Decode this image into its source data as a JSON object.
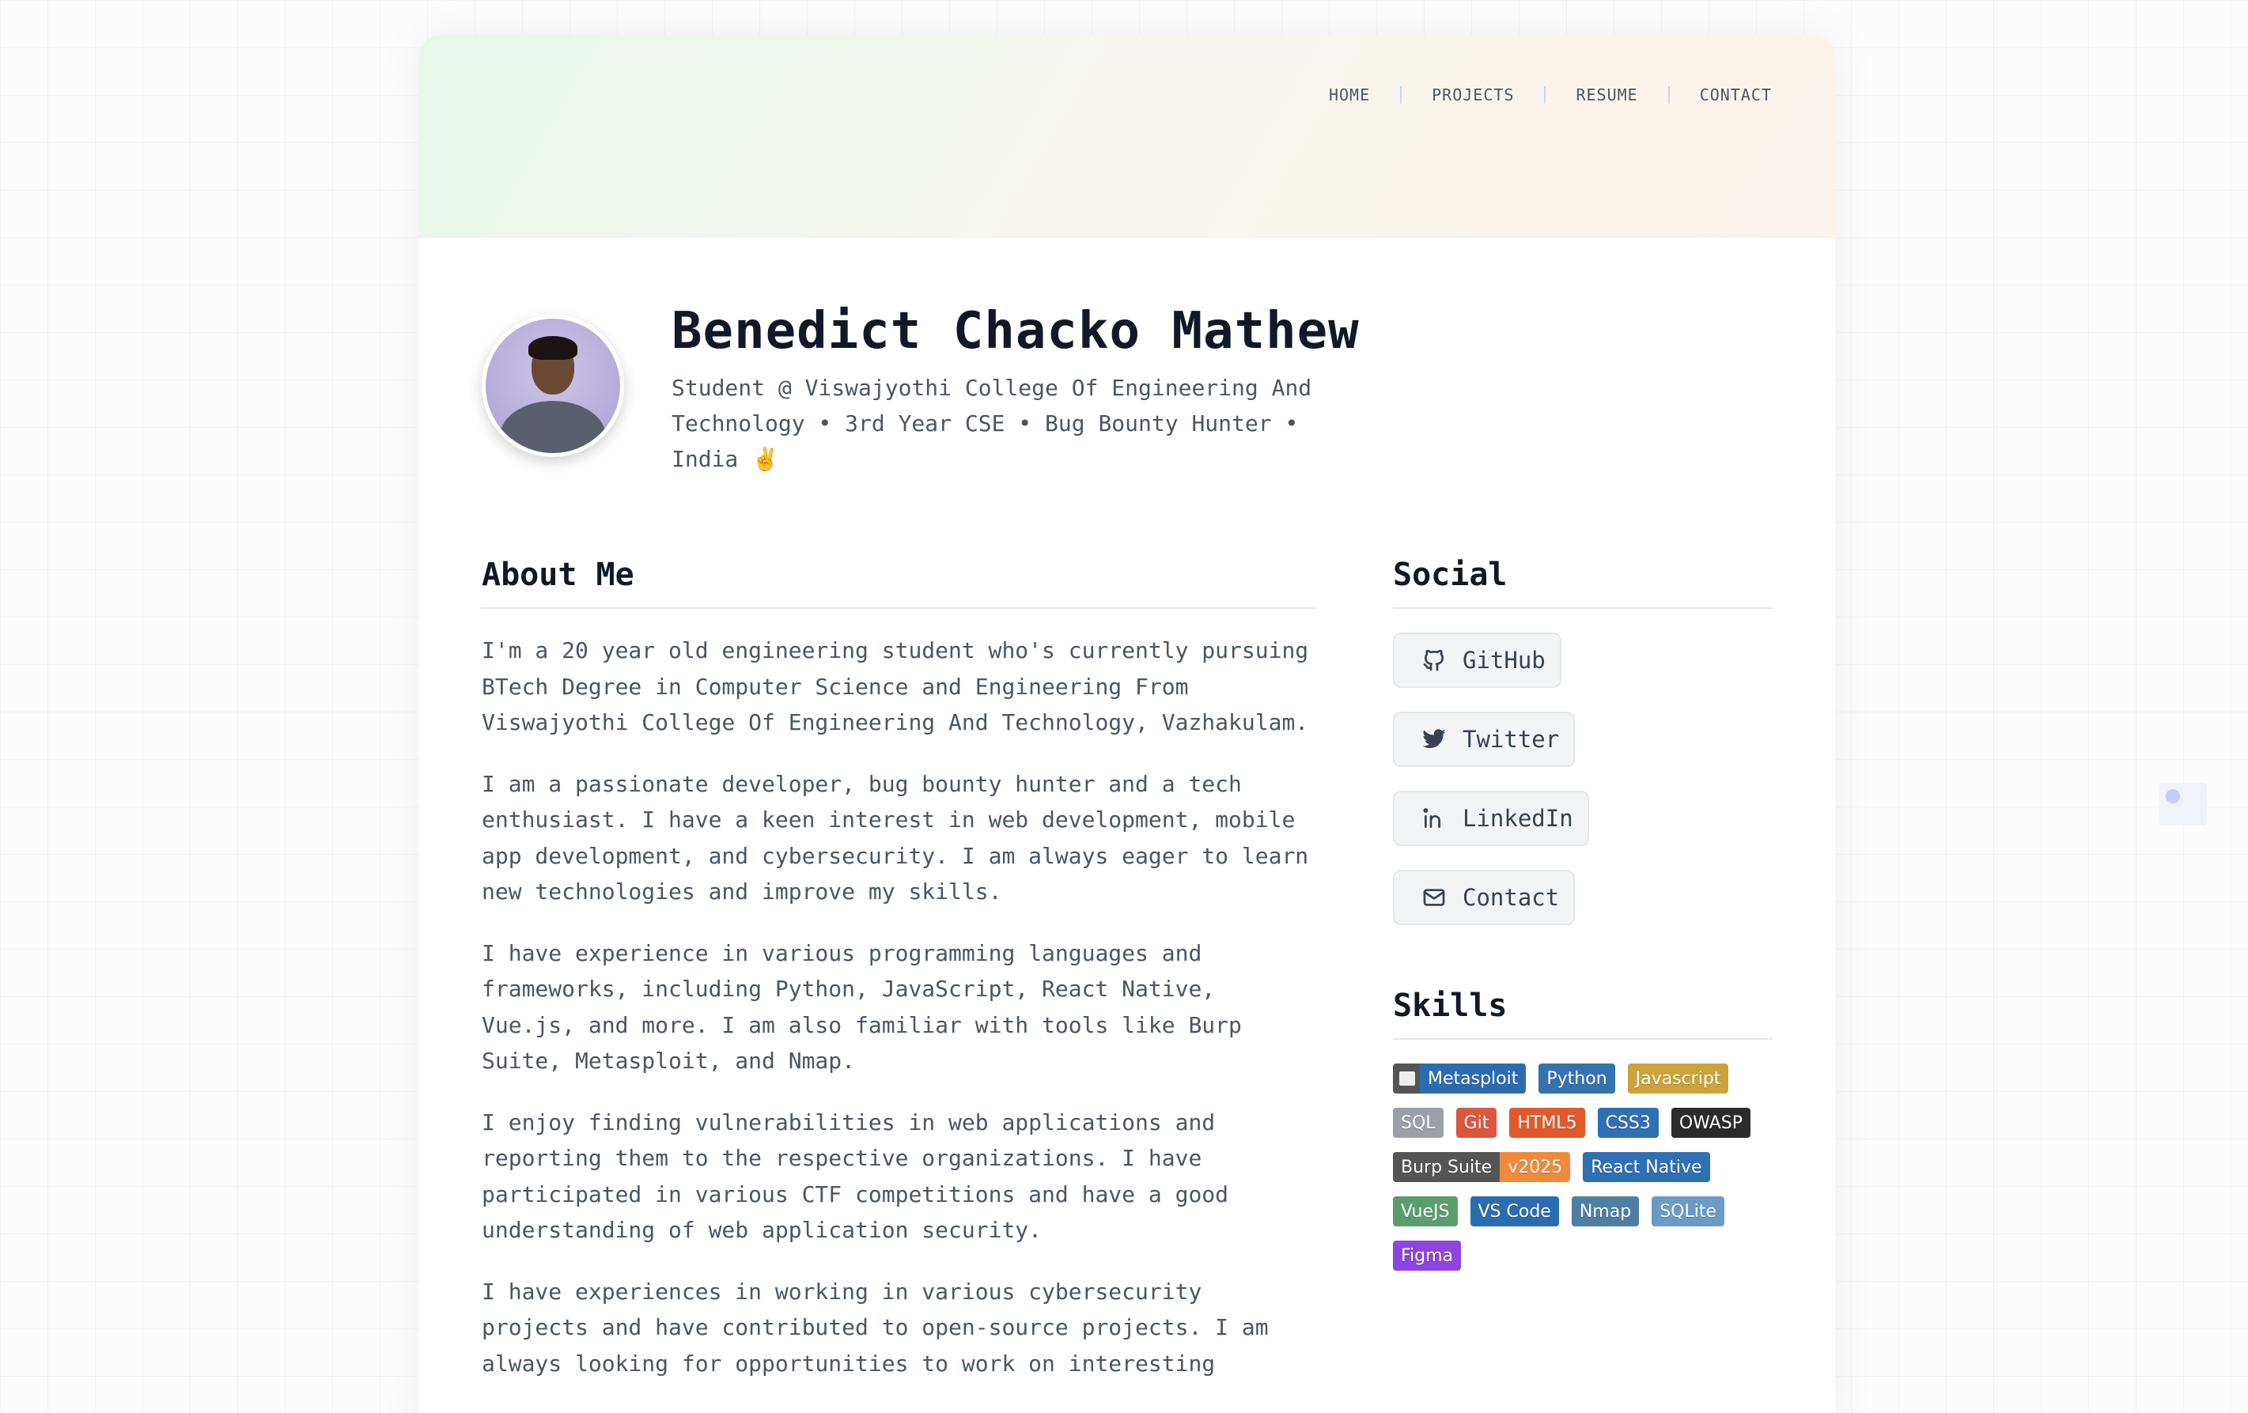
{
  "nav": {
    "items": [
      {
        "label": "HOME"
      },
      {
        "label": "PROJECTS"
      },
      {
        "label": "RESUME"
      },
      {
        "label": "CONTACT"
      }
    ]
  },
  "profile": {
    "name": "Benedict Chacko Mathew",
    "tagline": "Student @ Viswajyothi College Of Engineering And Technology • 3rd Year CSE • Bug Bounty Hunter • India ✌️"
  },
  "about": {
    "title": "About Me",
    "paragraphs": [
      "I'm a 20 year old engineering student who's currently pursuing BTech Degree in Computer Science and Engineering From Viswajyothi College Of Engineering And Technology, Vazhakulam.",
      "I am a passionate developer, bug bounty hunter and a tech enthusiast. I have a keen interest in web development, mobile app development, and cybersecurity. I am always eager to learn new technologies and improve my skills.",
      "I have experience in various programming languages and frameworks, including Python, JavaScript, React Native, Vue.js, and more. I am also familiar with tools like Burp Suite, Metasploit, and Nmap.",
      "I enjoy finding vulnerabilities in web applications and reporting them to the respective organizations. I have participated in various CTF competitions and have a good understanding of web application security.",
      "I have experiences in working in various cybersecurity projects and have contributed to open-source projects. I am always looking for opportunities to work on interesting"
    ]
  },
  "social": {
    "title": "Social",
    "links": [
      {
        "label": "GitHub",
        "icon": "github-icon"
      },
      {
        "label": "Twitter",
        "icon": "twitter-icon"
      },
      {
        "label": "LinkedIn",
        "icon": "linkedin-icon"
      },
      {
        "label": "Contact",
        "icon": "mail-icon"
      }
    ]
  },
  "skills": {
    "title": "Skills",
    "badges": [
      {
        "label": "Metasploit",
        "color": "#2b6cb0",
        "icon": "terminal-icon"
      },
      {
        "label": "Python",
        "color": "#3572b0"
      },
      {
        "label": "Javascript",
        "color": "#cba33a"
      },
      {
        "label": "SQL",
        "color": "#9aa0a6"
      },
      {
        "label": "Git",
        "color": "#d9583f"
      },
      {
        "label": "HTML5",
        "color": "#e05a2b"
      },
      {
        "label": "CSS3",
        "color": "#2f6fb3"
      },
      {
        "label": "OWASP",
        "color": "#2b2b2b"
      },
      {
        "label": "Burp Suite",
        "color": "#555555",
        "version": "v2025",
        "version_color": "#f08a3a"
      },
      {
        "label": "React Native",
        "color": "#2f6fb3"
      },
      {
        "label": "VueJS",
        "color": "#5c9d6e"
      },
      {
        "label": "VS Code",
        "color": "#2b6cb0"
      },
      {
        "label": "Nmap",
        "color": "#4f7ea3"
      },
      {
        "label": "SQLite",
        "color": "#6a9bc6"
      },
      {
        "label": "Figma",
        "color": "#8e44e0"
      }
    ]
  }
}
